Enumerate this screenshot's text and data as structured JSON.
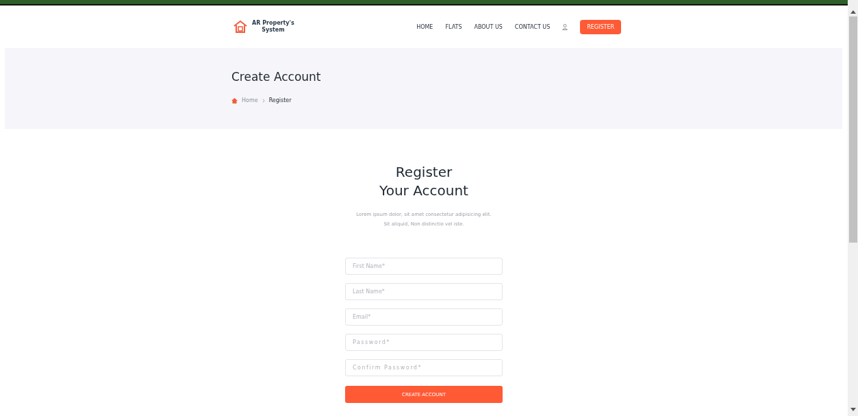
{
  "logo": {
    "line_1": "AR Property's",
    "line_2": "System"
  },
  "nav": [
    {
      "label": "HOME"
    },
    {
      "label": "FLATS"
    },
    {
      "label": "ABOUT US"
    },
    {
      "label": "CONTACT US"
    }
  ],
  "register_button": "REGISTER",
  "banner": {
    "title": "Create Account",
    "breadcrumb": [
      "Home",
      "Register"
    ]
  },
  "form": {
    "title_1": "Register",
    "title_2": "Your Account",
    "intro_1": "Lorem ipsum dolor, sit amet consectetur adipisicing elit.",
    "intro_2": "Sit aliquid, Non distinctio vel iste.",
    "fields": [
      {
        "placeholder": "First Name*",
        "kind": "text"
      },
      {
        "placeholder": "Last Name*",
        "kind": "text"
      },
      {
        "placeholder": "Email*",
        "kind": "email"
      },
      {
        "placeholder": "Password*",
        "kind": "password"
      },
      {
        "placeholder": "Confirm Password*",
        "kind": "password"
      }
    ],
    "submit": "CREATE ACCOUNT"
  }
}
